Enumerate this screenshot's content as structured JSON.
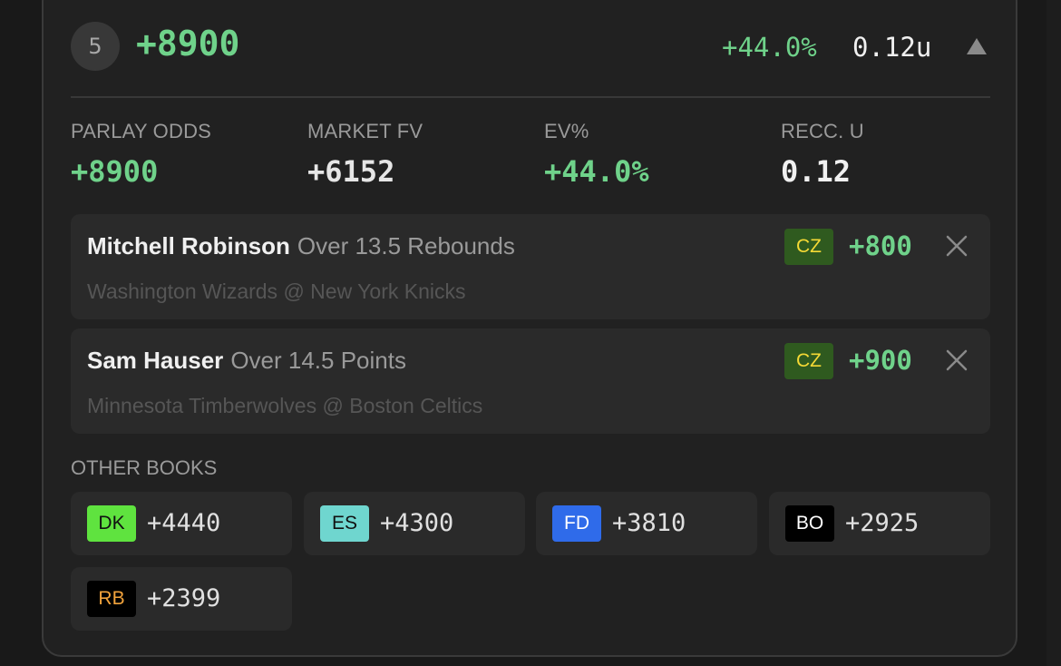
{
  "header": {
    "rank": "5",
    "odds": "+8900",
    "ev": "+44.0%",
    "units": "0.12u"
  },
  "stats": [
    {
      "label": "PARLAY ODDS",
      "value": "+8900"
    },
    {
      "label": "MARKET FV",
      "value": "+6152"
    },
    {
      "label": "EV%",
      "value": "+44.0%"
    },
    {
      "label": "RECC. U",
      "value": "0.12"
    }
  ],
  "legs": [
    {
      "player": "Mitchell Robinson",
      "market": "Over 13.5 Rebounds",
      "game": "Washington Wizards @ New York Knicks",
      "book": "CZ",
      "odds": "+800"
    },
    {
      "player": "Sam Hauser",
      "market": "Over 14.5 Points",
      "game": "Minnesota Timberwolves @ Boston Celtics",
      "book": "CZ",
      "odds": "+900"
    }
  ],
  "other_books": {
    "title": "OTHER BOOKS",
    "items": [
      {
        "book": "DK",
        "odds": "+4440"
      },
      {
        "book": "ES",
        "odds": "+4300"
      },
      {
        "book": "FD",
        "odds": "+3810"
      },
      {
        "book": "BO",
        "odds": "+2925"
      },
      {
        "book": "RB",
        "odds": "+2399"
      }
    ]
  },
  "colors": {
    "positive": "#6fd28a",
    "cz_bg": "#2f5a1f",
    "cz_fg": "#f5d935",
    "dk_bg": "#5fe33f",
    "dk_fg": "#111111",
    "es_bg": "#6fd6cf",
    "es_fg": "#111111",
    "fd_bg": "#2f6bea",
    "fd_fg": "#ffffff",
    "bo_bg": "#000000",
    "bo_fg": "#ffffff",
    "rb_bg": "#000000",
    "rb_fg": "#f2a33c"
  }
}
